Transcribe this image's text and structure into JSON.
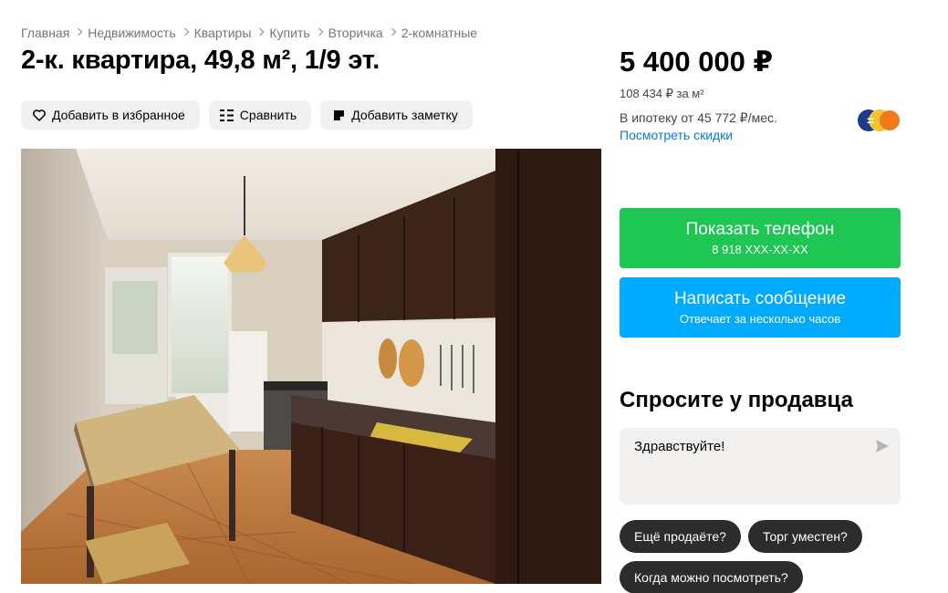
{
  "breadcrumb": [
    "Главная",
    "Недвижимость",
    "Квартиры",
    "Купить",
    "Вторичка",
    "2-комнатные"
  ],
  "title": "2-к. квартира, 49,8 м², 1/9 эт.",
  "actions": {
    "favorite": "Добавить в избранное",
    "compare": "Сравнить",
    "note": "Добавить заметку"
  },
  "price": {
    "total": "5 400 000 ₽",
    "per_sqm": "108 434 ₽ за м²",
    "mortgage": "В ипотеку от 45 772 ₽/мес.",
    "discount_link": "Посмотреть скидки"
  },
  "contact": {
    "phone_label": "Показать телефон",
    "phone_number": "8 918 XXX-XX-XX",
    "message_label": "Написать сообщение",
    "message_sub": "Отвечает за несколько часов"
  },
  "ask": {
    "title": "Спросите у продавца",
    "message": "Здравствуйте!",
    "chips": [
      "Ещё продаёте?",
      "Торг уместен?",
      "Когда можно посмотреть?"
    ]
  },
  "colors": {
    "phone_button": "#1ec653",
    "message_button": "#00aaff",
    "link": "#0a7ad6",
    "chip": "#2c2c2c"
  },
  "icons": [
    "heart-icon",
    "compare-icon",
    "note-icon",
    "send-icon",
    "bank-logo"
  ]
}
